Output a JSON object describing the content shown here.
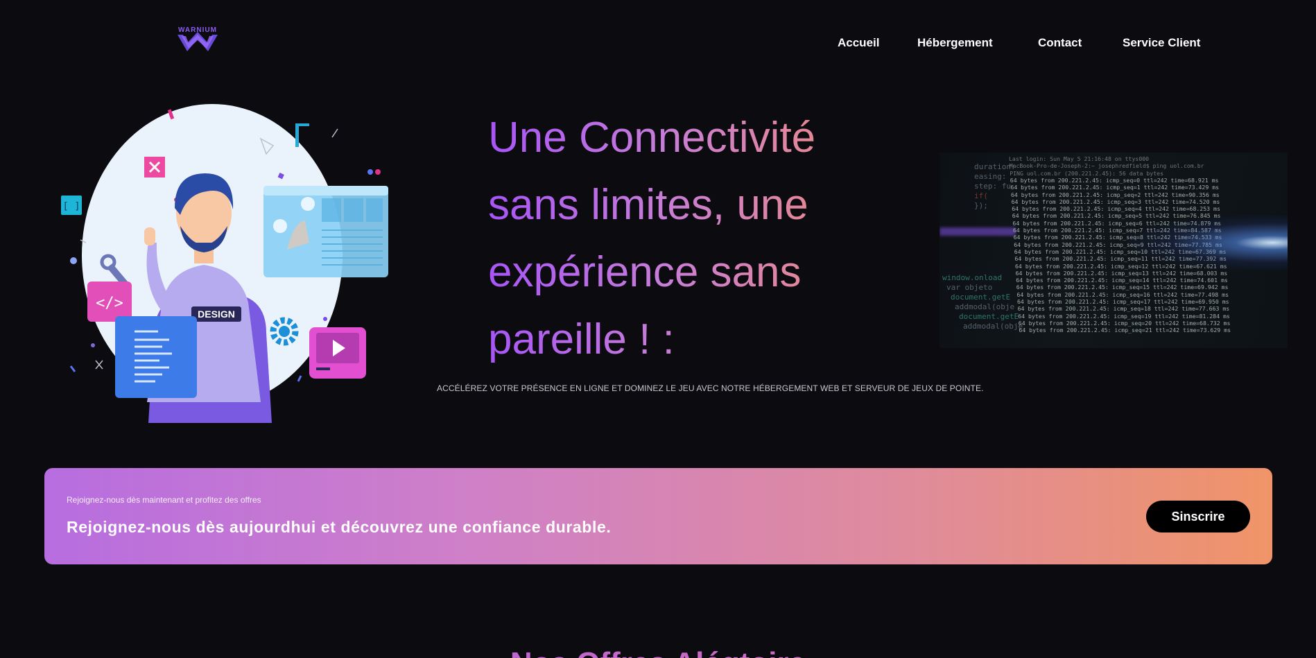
{
  "brand": {
    "logo_text": "WARNIUM",
    "logo_icon": "w-chevron-logo-icon",
    "accent": "#8a5cf0"
  },
  "nav": {
    "items": [
      {
        "label": "Accueil"
      },
      {
        "label": "Hébergement"
      },
      {
        "label": "Contact"
      },
      {
        "label": "Service Client"
      }
    ]
  },
  "hero": {
    "title": "Une Connectivité sans limites, une expérience sans pareille ! :",
    "subtitle": "ACCÉLÉREZ VOTRE PRÉSENCE EN LIGNE ET DOMINEZ LE JEU AVEC NOTRE HÉBERGEMENT WEB ET SERVEUR DE JEUX DE POINTE.",
    "illustration": {
      "badge_label": "DESIGN",
      "icons": [
        "code-icon",
        "play-icon",
        "gear-icon",
        "close-icon",
        "brackets-icon",
        "wrench-icon"
      ]
    },
    "terminal": {
      "header": [
        "Last login: Sun May  5 21:16:48 on ttys000",
        "MacBook-Pro-de-Joseph-2:~ josephredfield$ ping uol.com.br",
        "PING uol.com.br (200.221.2.45): 56 data bytes"
      ],
      "lines": [
        "64 bytes from 200.221.2.45: icmp_seq=0 ttl=242 time=68.921 ms",
        "64 bytes from 200.221.2.45: icmp_seq=1 ttl=242 time=73.429 ms",
        "64 bytes from 200.221.2.45: icmp_seq=2 ttl=242 time=90.356 ms",
        "64 bytes from 200.221.2.45: icmp_seq=3 ttl=242 time=74.520 ms",
        "64 bytes from 200.221.2.45: icmp_seq=4 ttl=242 time=68.253 ms",
        "64 bytes from 200.221.2.45: icmp_seq=5 ttl=242 time=76.845 ms",
        "64 bytes from 200.221.2.45: icmp_seq=6 ttl=242 time=74.879 ms",
        "64 bytes from 200.221.2.45: icmp_seq=7 ttl=242 time=84.587 ms",
        "64 bytes from 200.221.2.45: icmp_seq=8 ttl=242 time=74.533 ms",
        "64 bytes from 200.221.2.45: icmp_seq=9 ttl=242 time=77.785 ms",
        "64 bytes from 200.221.2.45: icmp_seq=10 ttl=242 time=67.369 ms",
        "64 bytes from 200.221.2.45: icmp_seq=11 ttl=242 time=77.392 ms",
        "64 bytes from 200.221.2.45: icmp_seq=12 ttl=242 time=67.621 ms",
        "64 bytes from 200.221.2.45: icmp_seq=13 ttl=242 time=68.003 ms",
        "64 bytes from 200.221.2.45: icmp_seq=14 ttl=242 time=74.601 ms",
        "64 bytes from 200.221.2.45: icmp_seq=15 ttl=242 time=69.942 ms",
        "64 bytes from 200.221.2.45: icmp_seq=16 ttl=242 time=77.498 ms",
        "64 bytes from 200.221.2.45: icmp_seq=17 ttl=242 time=69.950 ms",
        "64 bytes from 200.221.2.45: icmp_seq=18 ttl=242 time=77.663 ms",
        "64 bytes from 200.221.2.45: icmp_seq=19 ttl=242 time=81.284 ms",
        "64 bytes from 200.221.2.45: icmp_seq=20 ttl=242 time=68.732 ms",
        "64 bytes from 200.221.2.45: icmp_seq=21 ttl=242 time=73.629 ms"
      ],
      "code": [
        "duration:",
        "easing:",
        "step: fu",
        "if(",
        "});",
        "window.onload",
        "var objeto",
        "document.getE",
        "addmodal(obje",
        "document.getE",
        "addmodal(obje"
      ]
    }
  },
  "cta": {
    "small_text": "Rejoignez-nous dès maintenant et profitez des offres",
    "headline": "Rejoignez-nous dès aujourdhui et découvrez une confiance durable.",
    "button_label": "Sinscrire"
  },
  "offers": {
    "heading": "Nos Offres Alégtoire"
  }
}
